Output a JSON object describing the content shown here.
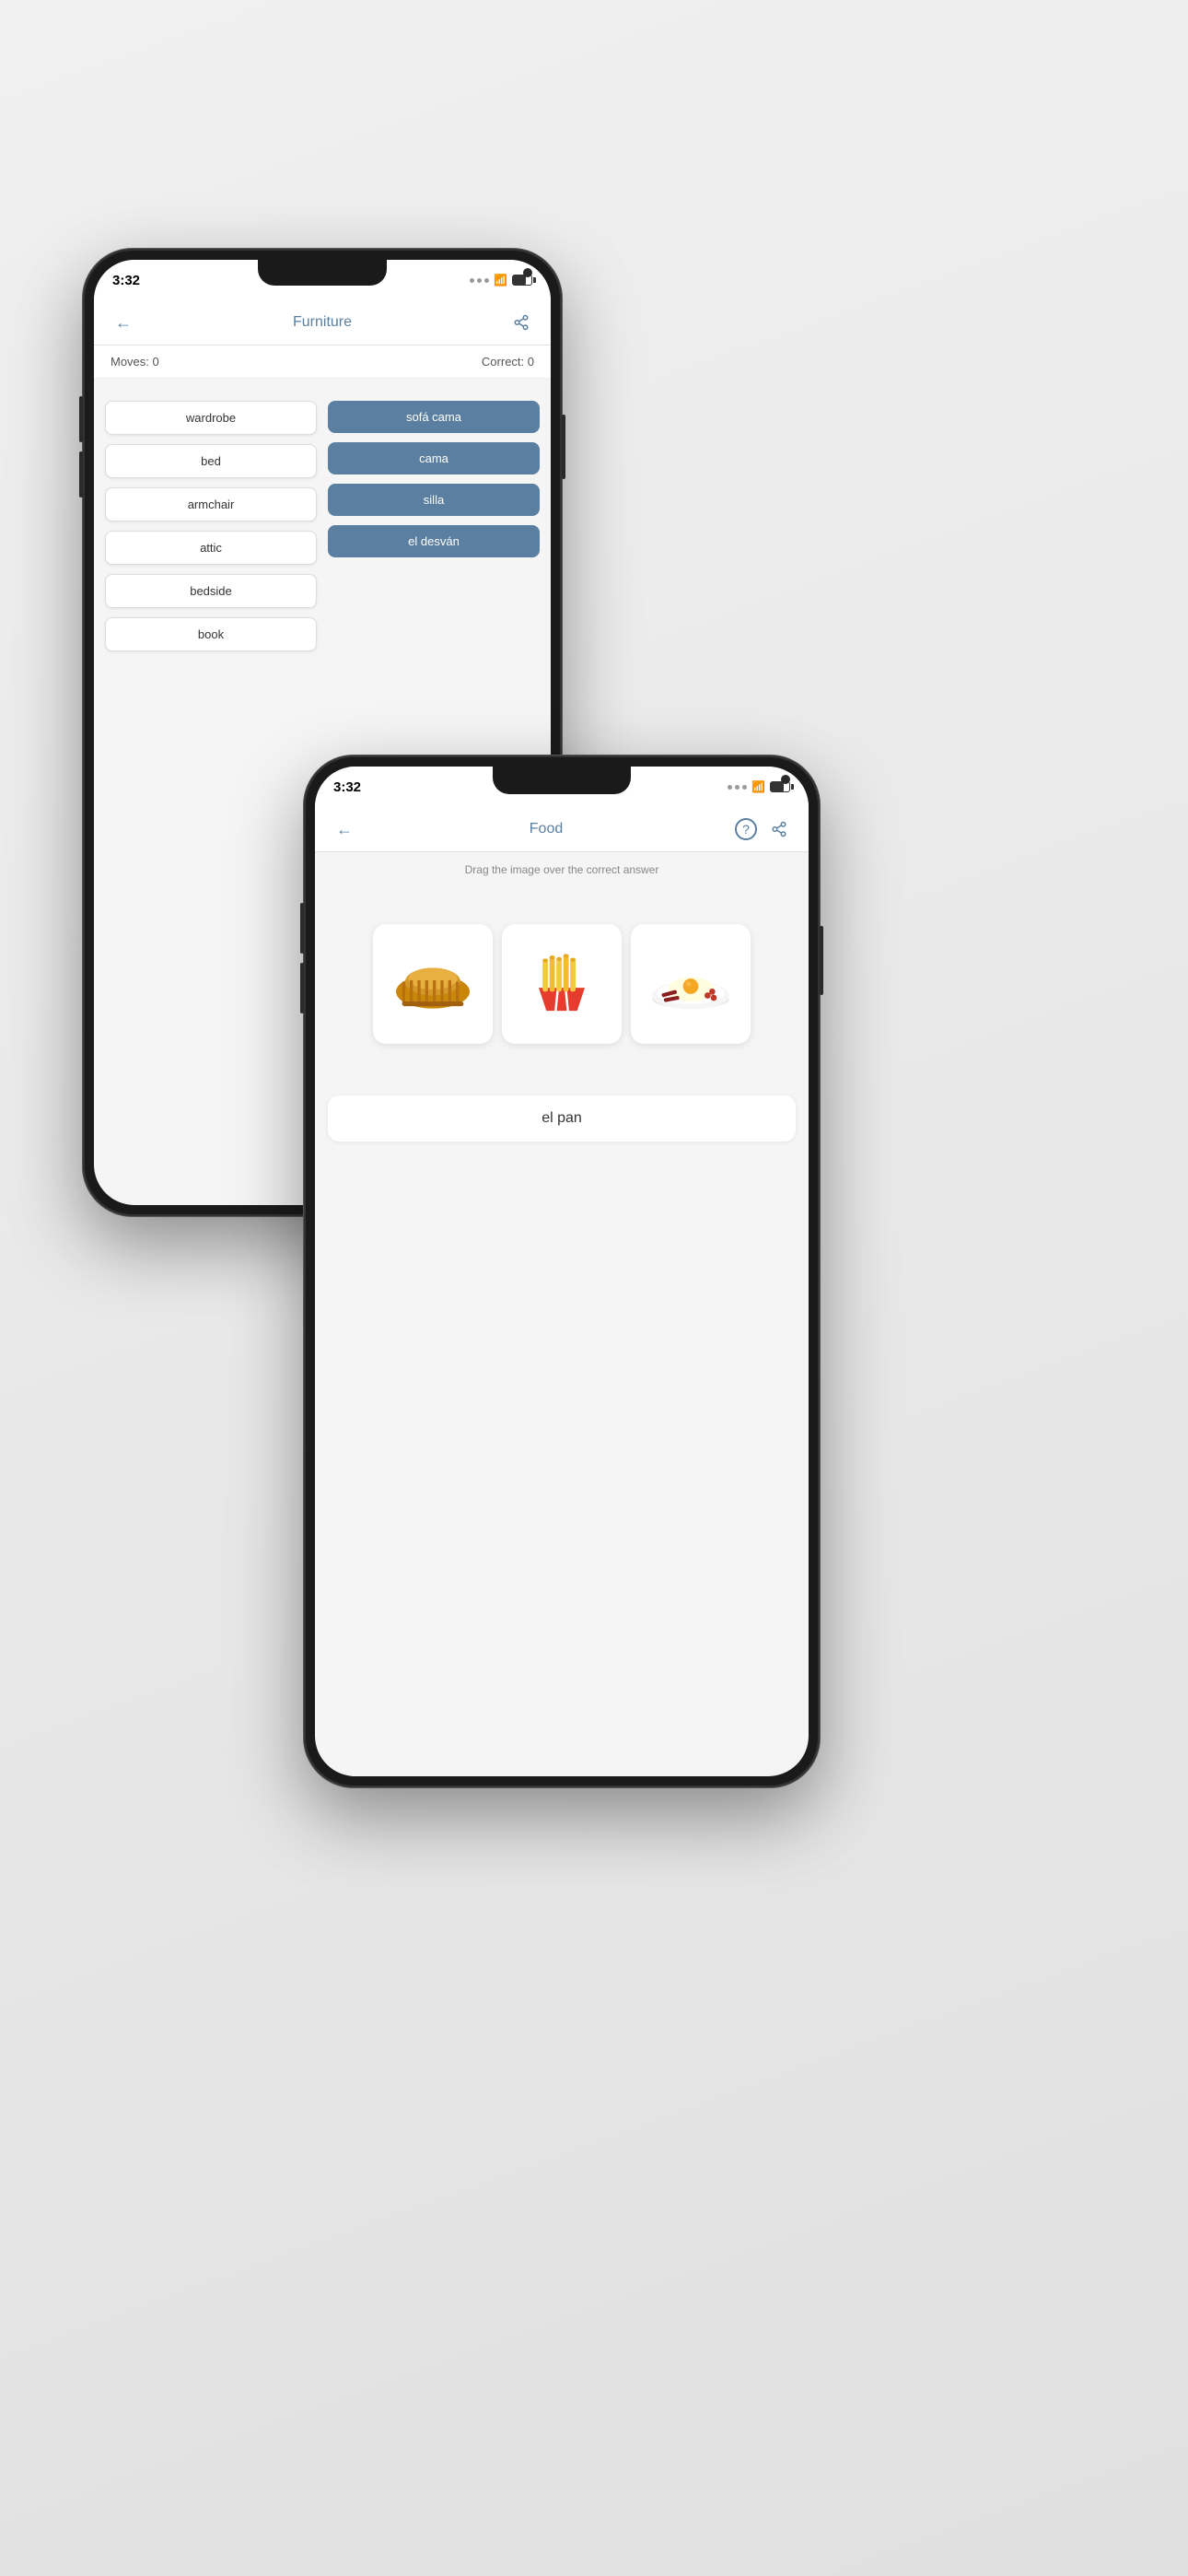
{
  "background": "#e8e8e8",
  "phone_back": {
    "status": {
      "time": "3:32"
    },
    "nav": {
      "title": "Furniture",
      "back_label": "←",
      "share_label": "⬆"
    },
    "stats": {
      "moves_label": "Moves: 0",
      "correct_label": "Correct: 0"
    },
    "words_left": [
      "wardrobe",
      "bed",
      "armchair",
      "attic",
      "bedside",
      "book"
    ],
    "words_right": [
      "sofá cama",
      "cama",
      "silla",
      "el desván"
    ]
  },
  "phone_front": {
    "status": {
      "time": "3:32"
    },
    "nav": {
      "title": "Food",
      "back_label": "←",
      "help_label": "?",
      "share_label": "⬆"
    },
    "instruction": "Drag the image over the correct answer",
    "food_items": [
      {
        "name": "bread",
        "label": "bread"
      },
      {
        "name": "fries",
        "label": "fries"
      },
      {
        "name": "egg-plate",
        "label": "egg plate"
      }
    ],
    "answer_label": "el pan"
  }
}
